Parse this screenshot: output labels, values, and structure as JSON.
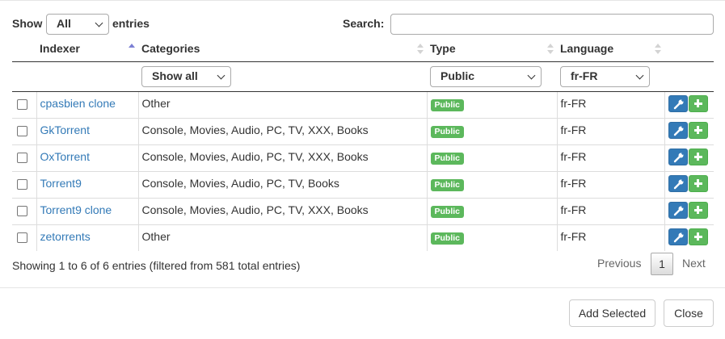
{
  "length": {
    "show_label": "Show",
    "selected": "All",
    "suffix": "entries"
  },
  "search": {
    "label": "Search:",
    "value": "",
    "placeholder": ""
  },
  "columns": {
    "indexer": "Indexer",
    "categories": "Categories",
    "type": "Type",
    "language": "Language"
  },
  "filters": {
    "categories": "Show all",
    "type": "Public",
    "language": "fr-FR"
  },
  "rows": [
    {
      "name": "cpasbien clone",
      "categories": "Other",
      "type": "Public",
      "language": "fr-FR"
    },
    {
      "name": "GkTorrent",
      "categories": "Console, Movies, Audio, PC, TV, XXX, Books",
      "type": "Public",
      "language": "fr-FR"
    },
    {
      "name": "OxTorrent",
      "categories": "Console, Movies, Audio, PC, TV, XXX, Books",
      "type": "Public",
      "language": "fr-FR"
    },
    {
      "name": "Torrent9",
      "categories": "Console, Movies, Audio, PC, TV, Books",
      "type": "Public",
      "language": "fr-FR"
    },
    {
      "name": "Torrent9 clone",
      "categories": "Console, Movies, Audio, PC, TV, XXX, Books",
      "type": "Public",
      "language": "fr-FR"
    },
    {
      "name": "zetorrents",
      "categories": "Other",
      "type": "Public",
      "language": "fr-FR"
    }
  ],
  "info": "Showing 1 to 6 of 6 entries (filtered from 581 total entries)",
  "pagination": {
    "previous": "Previous",
    "current": "1",
    "next": "Next"
  },
  "footer": {
    "add_selected": "Add Selected",
    "close": "Close"
  },
  "colors": {
    "link": "#337ab7",
    "badge": "#5cb85c",
    "config_button": "#337ab7",
    "add_button": "#5cb85c",
    "sort_active": "#7b7fd4"
  },
  "icons": {
    "config": "wrench-icon",
    "add": "plus-icon"
  }
}
